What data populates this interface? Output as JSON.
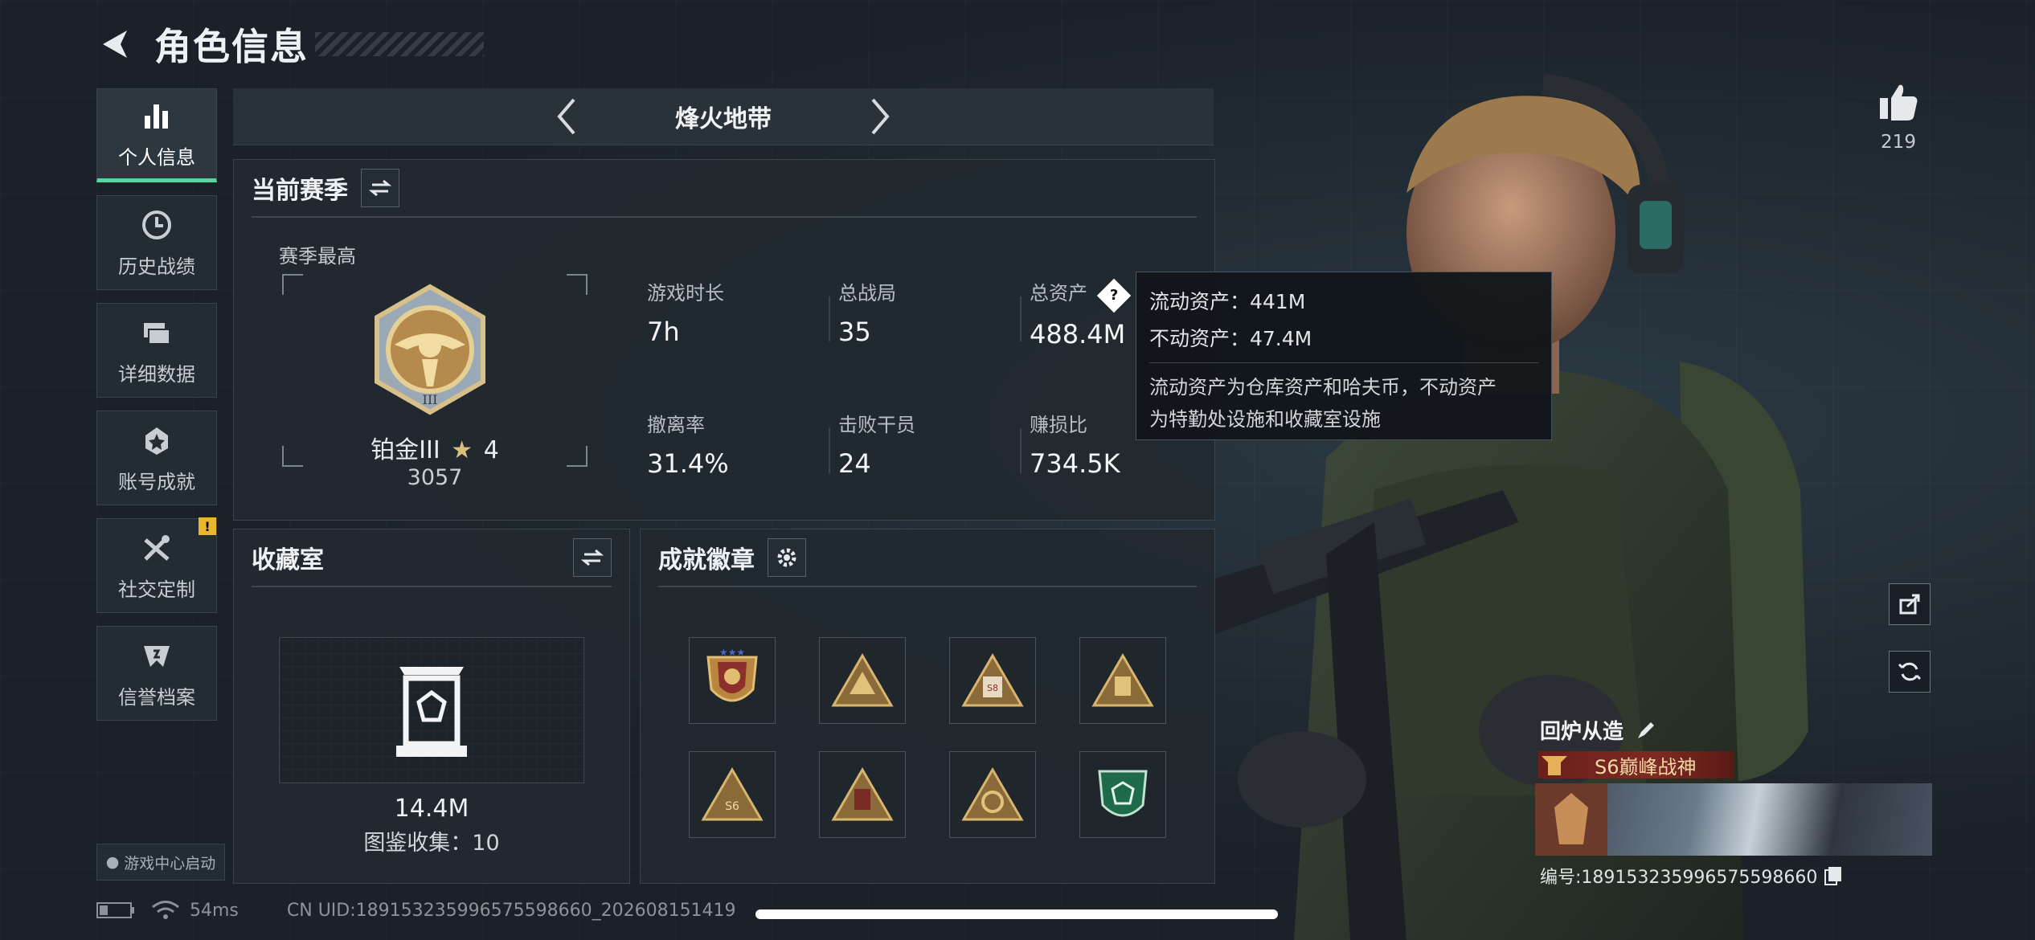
{
  "header": {
    "title": "角色信息"
  },
  "nav": {
    "items": [
      {
        "label": "个人信息",
        "icon": "bar-chart-icon"
      },
      {
        "label": "历史战绩",
        "icon": "clock-icon"
      },
      {
        "label": "详细数据",
        "icon": "folder-icon"
      },
      {
        "label": "账号成就",
        "icon": "medal-icon"
      },
      {
        "label": "社交定制",
        "icon": "tools-icon",
        "badge": "!"
      },
      {
        "label": "信誉档案",
        "icon": "shield-icon"
      }
    ],
    "game_center": "游戏中心启动"
  },
  "mode": {
    "name": "烽火地带"
  },
  "season": {
    "title": "当前赛季",
    "best_label": "赛季最高",
    "rank_name": "铂金III",
    "rank_stars": "4",
    "rank_score": "3057",
    "stats": [
      {
        "label": "游戏时长",
        "value": "7h"
      },
      {
        "label": "总战局",
        "value": "35"
      },
      {
        "label": "总资产",
        "value": "488.4M"
      },
      {
        "label": "撤离率",
        "value": "31.4%"
      },
      {
        "label": "击败干员",
        "value": "24"
      },
      {
        "label": "赚损比",
        "value": "734.5K"
      }
    ]
  },
  "tooltip": {
    "liquid": "流动资产：441M",
    "fixed": "不动资产：47.4M",
    "desc_1": "流动资产为仓库资产和哈夫币，不动资产",
    "desc_2": "为特勤处设施和收藏室设施"
  },
  "collection": {
    "title": "收藏室",
    "value": "14.4M",
    "count_text": "图鉴收集：10"
  },
  "badges": {
    "title": "成就徽章",
    "items": [
      "badge-1",
      "badge-2",
      "badge-3",
      "badge-4",
      "badge-5",
      "badge-6",
      "badge-7",
      "badge-8"
    ]
  },
  "likes": {
    "count": "219"
  },
  "character": {
    "title": "回炉从造",
    "rank_tag": "S6巅峰战神",
    "id_text": "编号:1891532359965755986​60"
  },
  "status": {
    "ping": "54ms",
    "uid": "CN UID:1891532359965755986​60_202608151419"
  },
  "colors": {
    "accent": "#53d6a0",
    "warning": "#e8b72e",
    "gold": "#c9a55b"
  }
}
